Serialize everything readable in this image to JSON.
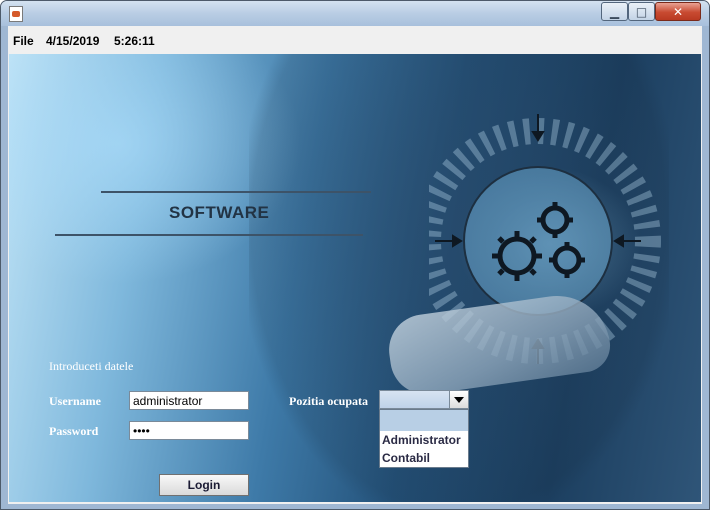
{
  "window": {
    "controls": {
      "minimize": "▁",
      "maximize": "□",
      "close": "✕"
    }
  },
  "menubar": {
    "file_label": "File",
    "date": "4/15/2019",
    "time": "5:26:11"
  },
  "banner": {
    "title": "SOFTWARE"
  },
  "form": {
    "heading": "Introduceti datele",
    "username_label": "Username",
    "username_value": "administrator",
    "password_label": "Password",
    "password_value": "••••",
    "position_label": "Pozitia ocupata",
    "position_selected": "",
    "position_options": [
      "Administrator",
      "Contabil"
    ],
    "login_label": "Login"
  },
  "colors": {
    "label_text": "#ffffff",
    "selected_item": "#b8cfe5"
  }
}
